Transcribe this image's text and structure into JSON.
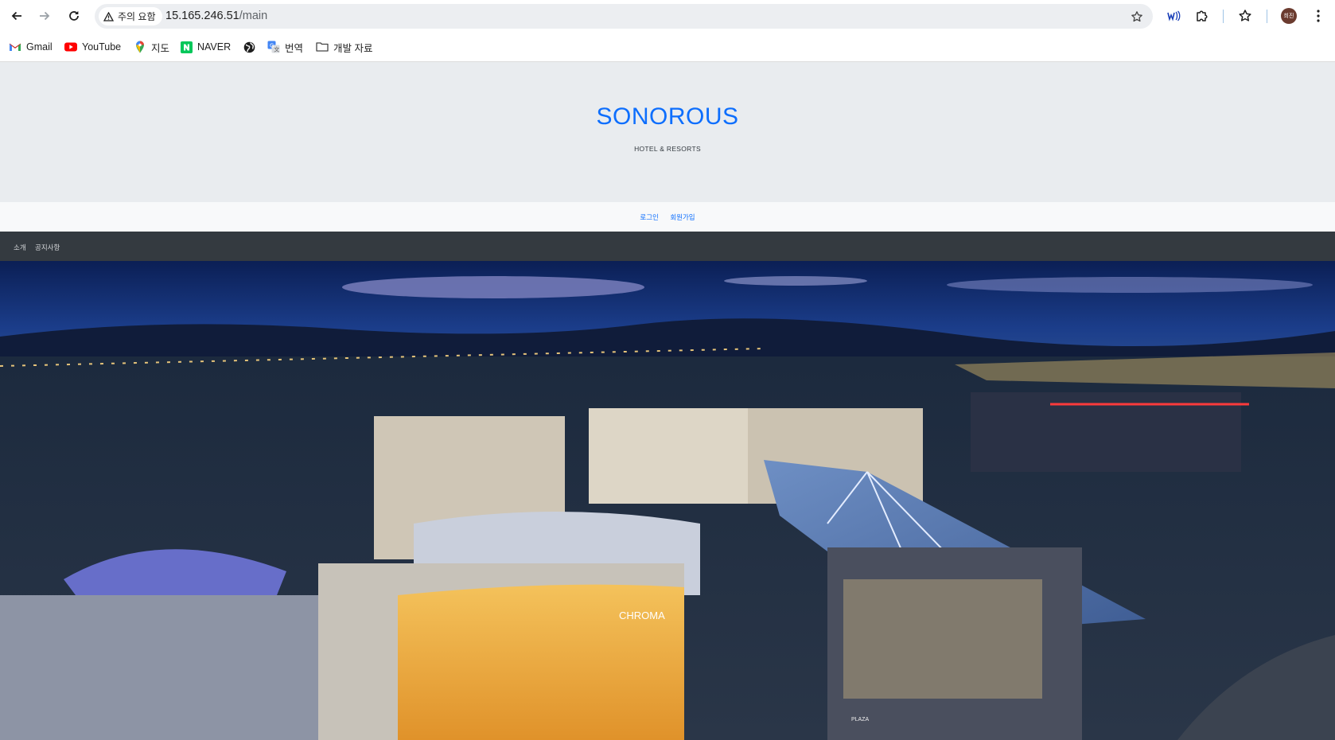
{
  "browser": {
    "security_label": "주의 요함",
    "url_host": "15.165.246.51",
    "url_path": "/main",
    "avatar_text": "희진",
    "bookmarks": [
      {
        "label": "Gmail",
        "icon": "gmail-icon"
      },
      {
        "label": "YouTube",
        "icon": "youtube-icon"
      },
      {
        "label": "지도",
        "icon": "maps-pin-icon"
      },
      {
        "label": "NAVER",
        "icon": "naver-icon"
      },
      {
        "label": "",
        "icon": "globe-icon"
      },
      {
        "label": "번역",
        "icon": "translate-icon"
      },
      {
        "label": "개발 자료",
        "icon": "folder-icon"
      }
    ]
  },
  "header": {
    "brand": "SONOROUS",
    "tagline": "HOTEL & RESORTS"
  },
  "auth": {
    "login": "로그인",
    "signup": "회원가입"
  },
  "nav": {
    "items": [
      "소개",
      "공지사항"
    ]
  },
  "hero": {
    "sign_text": "CHROMA",
    "plaza_text": "PLAZA"
  },
  "colors": {
    "brand": "#0d6efd",
    "header_bg": "#e9ecef",
    "nav_bg": "#343a40"
  }
}
